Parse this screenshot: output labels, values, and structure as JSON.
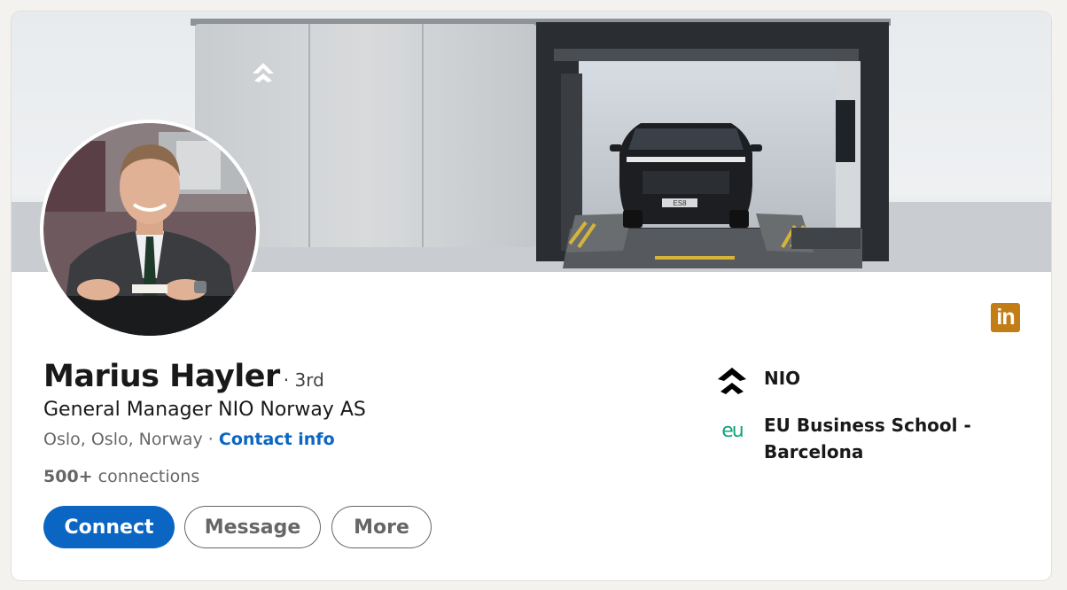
{
  "profile": {
    "name": "Marius Hayler",
    "degree": "· 3rd",
    "headline": "General Manager NIO Norway AS",
    "location": "Oslo, Oslo, Norway",
    "location_sep": " · ",
    "contact_info_label": "Contact info",
    "connections_count": "500+",
    "connections_label": "connections"
  },
  "actions": {
    "connect_label": "Connect",
    "message_label": "Message",
    "more_label": "More"
  },
  "experience": [
    {
      "label": "NIO",
      "icon": "nio-logo-icon"
    },
    {
      "label_line1": "EU Business School -",
      "label_line2": "Barcelona",
      "icon": "eu-logo-icon",
      "logo_text": "eu"
    }
  ],
  "banner": {
    "plate_text": "ES8"
  },
  "icons": {
    "linkedin": {
      "name": "linkedin-icon",
      "text": "in"
    }
  },
  "colors": {
    "primary": "#0a66c2",
    "linkedin_badge": "#c37d16",
    "eu_green": "#13a37f"
  }
}
